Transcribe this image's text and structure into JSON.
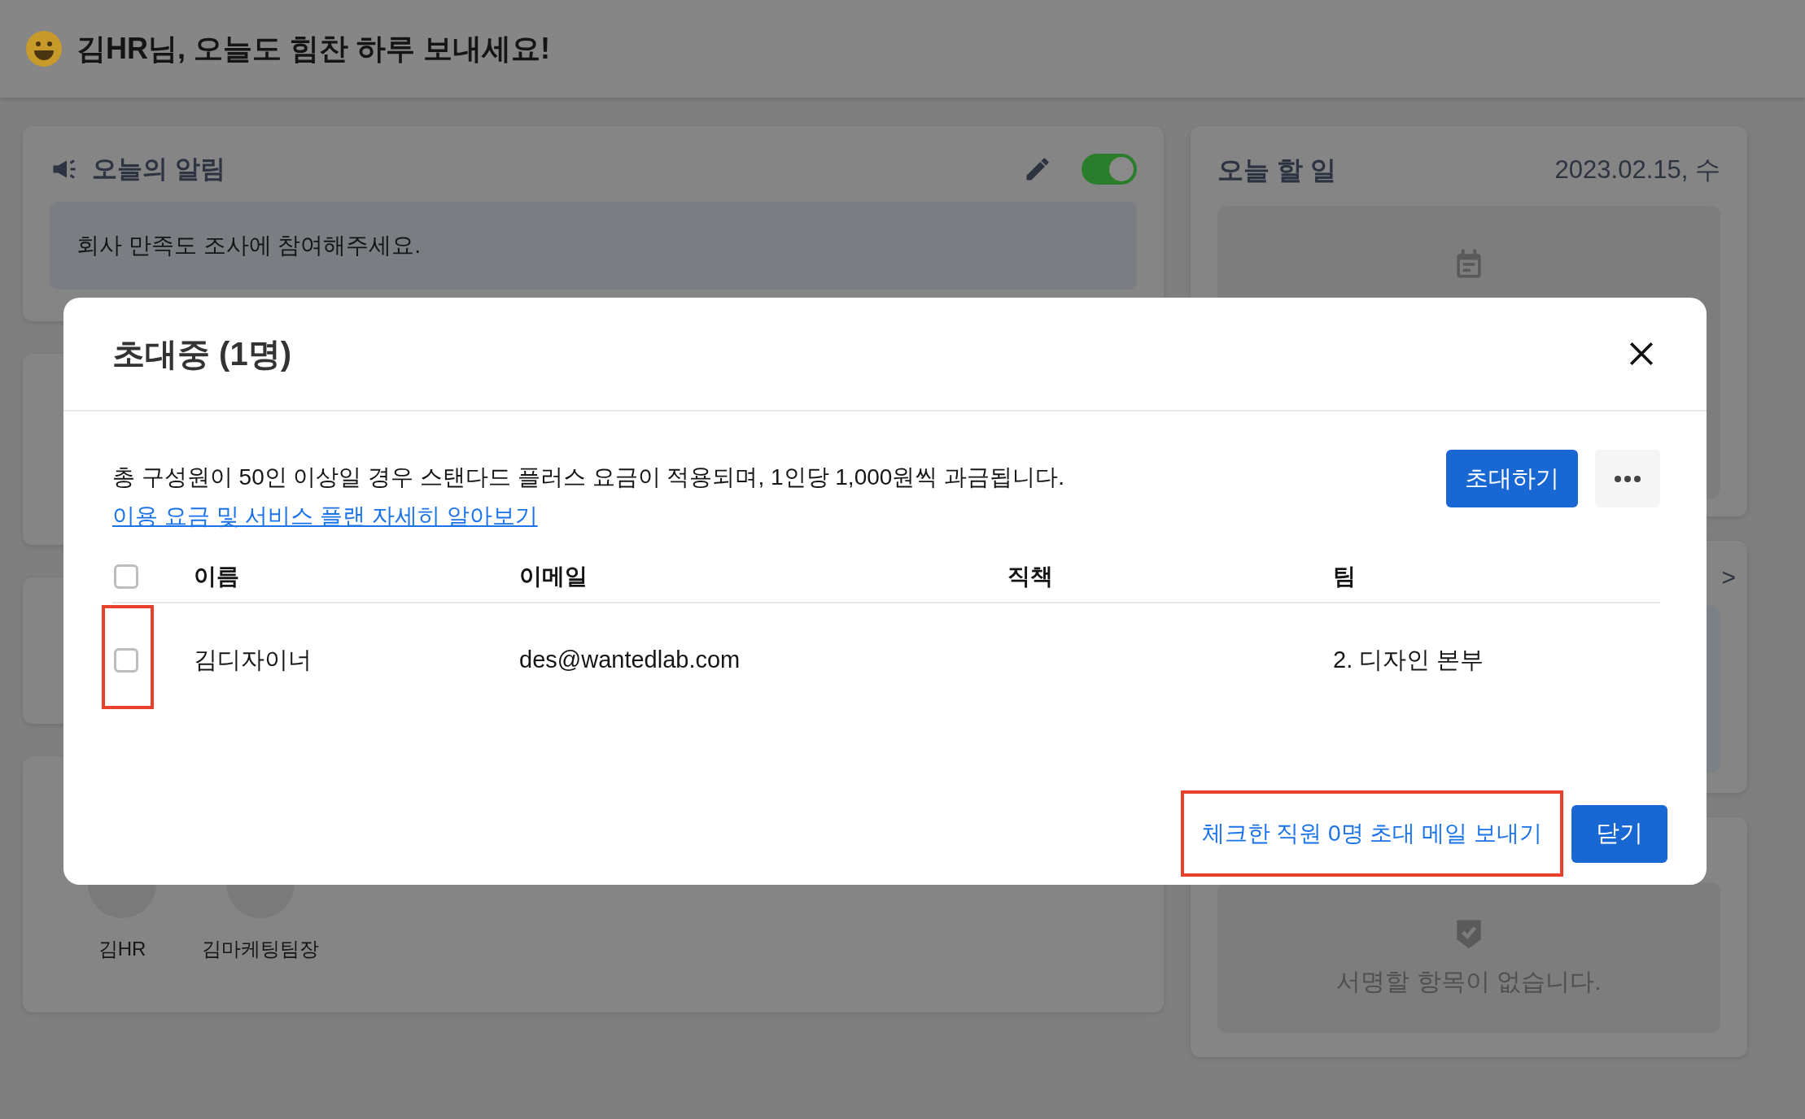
{
  "header": {
    "greeting": "김HR님, 오늘도 힘찬 하루 보내세요!"
  },
  "notice_card": {
    "title": "오늘의 알림",
    "on": true,
    "message": "회사 만족도 조사에 참여해주세요."
  },
  "todo_card": {
    "title": "오늘 할 일",
    "date": "2023.02.15, 수"
  },
  "next_card": {
    "arrow": ">"
  },
  "sign_card": {
    "empty_text": "서명할 항목이 없습니다."
  },
  "members_card": {
    "members": [
      {
        "name": "김HR"
      },
      {
        "name": "김마케팅팀장"
      }
    ]
  },
  "modal": {
    "title": "초대중 (1명)",
    "notice": "총 구성원이 50인 이상일 경우 스탠다드 플러스 요금이 적용되며, 1인당 1,000원씩 과금됩니다.",
    "link": "이용 요금 및 서비스 플랜 자세히 알아보기",
    "invite_button": "초대하기",
    "select_all": {
      "checked": false
    },
    "columns": [
      "이름",
      "이메일",
      "직책",
      "팀"
    ],
    "rows": [
      {
        "checked": false,
        "highlighted": true,
        "name": "김디자이너",
        "email": "des@wantedlab.com",
        "team": "2. 디자인 본부"
      }
    ],
    "send_link": {
      "label": "체크한 직원 0명 초대 메일 보내기",
      "highlighted": true
    },
    "close_button": "닫기"
  }
}
